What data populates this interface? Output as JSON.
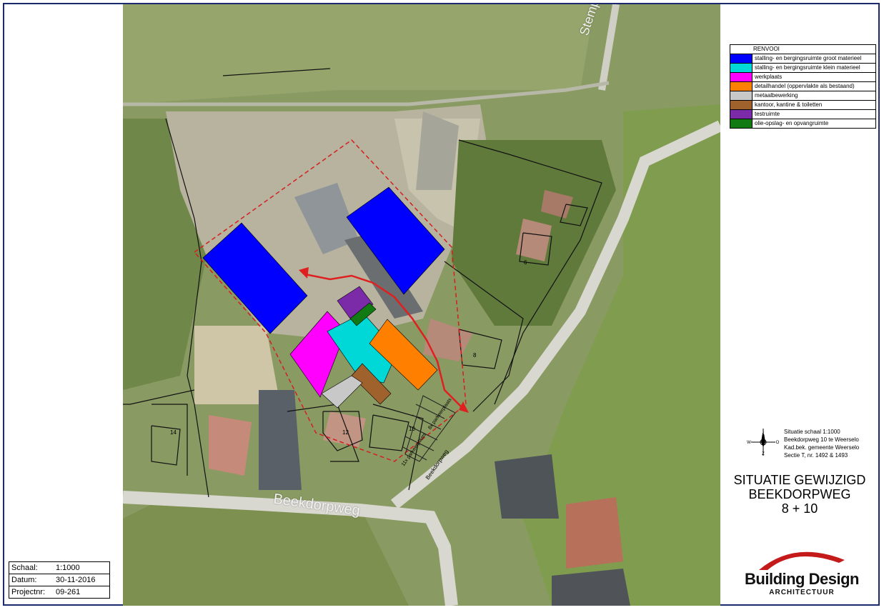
{
  "legend": {
    "title": "RENVOOI",
    "items": [
      {
        "color": "#0000ff",
        "label": "stalling- en bergingsruimte groot materieel"
      },
      {
        "color": "#00d8d8",
        "label": "stalling- en bergingsruimte klein materieel"
      },
      {
        "color": "#ff00ff",
        "label": "werkplaats"
      },
      {
        "color": "#ff8000",
        "label": "detailhandel (oppervlakte als bestaand)"
      },
      {
        "color": "#c8c8c8",
        "label": "metaalbewerking"
      },
      {
        "color": "#a0622d",
        "label": "kantoor, kantine & toiletten"
      },
      {
        "color": "#7b2aa8",
        "label": "testruimte"
      },
      {
        "color": "#127a12",
        "label": "olie-opslag- en opvangruimte"
      }
    ]
  },
  "info": {
    "line1": "Situatie schaal 1:1000",
    "line2": "Beekdorpweg 10 te Weerselo",
    "line3": "Kad.bek. gemeente Weerselo",
    "line4": "Sectie T, nr. 1492 & 1493"
  },
  "compass": {
    "north": "N",
    "south": "Z",
    "west": "W",
    "east": "O"
  },
  "sheet_title": {
    "line1": "SITUATIE GEWIJZIGD",
    "line2": "BEEKDORPWEG",
    "line3": "8 + 10"
  },
  "brand": {
    "name": "Building Design",
    "sub": "ARCHITECTUUR"
  },
  "titleblock": [
    {
      "key": "Schaal:",
      "value": "1:1000"
    },
    {
      "key": "Datum:",
      "value": "30-11-2016"
    },
    {
      "key": "Projectnr:",
      "value": "09-261"
    }
  ],
  "map": {
    "street_beekdorpweg": "Beekdorpweg",
    "street_stempel": "Stempels",
    "street_small": "Beekdorpweg",
    "house_numbers": [
      "6",
      "8",
      "10",
      "12",
      "14"
    ],
    "parking_a": "8x parkeerplaats",
    "parking_b": "11x parkeerplaats"
  },
  "colors": {
    "frame": "#1a2a6c",
    "route_arrow": "#e02020",
    "plot_boundary": "#d42020",
    "brand_arc": "#c41a1a"
  }
}
